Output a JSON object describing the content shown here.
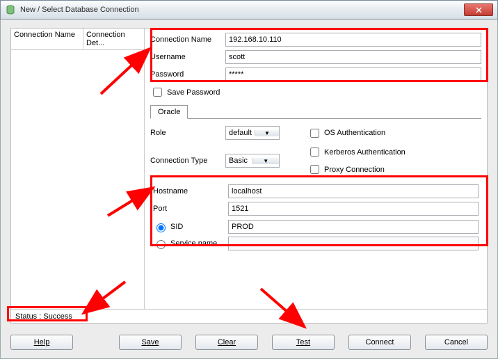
{
  "window": {
    "title": "New / Select Database Connection"
  },
  "list": {
    "col1": "Connection Name",
    "col2": "Connection Det..."
  },
  "form": {
    "connName_label": "Connection Name",
    "connName_value": "192.168.10.110",
    "username_label": "Username",
    "username_value": "scott",
    "password_label": "Password",
    "password_value": "*****",
    "savepw_label": "Save Password"
  },
  "tabs": {
    "oracle": "Oracle"
  },
  "oracle": {
    "role_label": "Role",
    "role_value": "default",
    "conntype_label": "Connection Type",
    "conntype_value": "Basic",
    "os_auth": "OS Authentication",
    "kerberos": "Kerberos Authentication",
    "proxy": "Proxy Connection",
    "hostname_label": "Hostname",
    "hostname_value": "localhost",
    "port_label": "Port",
    "port_value": "1521",
    "sid_label": "SID",
    "sid_value": "PROD",
    "service_label": "Service name",
    "service_value": ""
  },
  "status": {
    "text": "Status : Success"
  },
  "buttons": {
    "help": "Help",
    "save": "Save",
    "clear": "Clear",
    "test": "Test",
    "connect": "Connect",
    "cancel": "Cancel"
  }
}
